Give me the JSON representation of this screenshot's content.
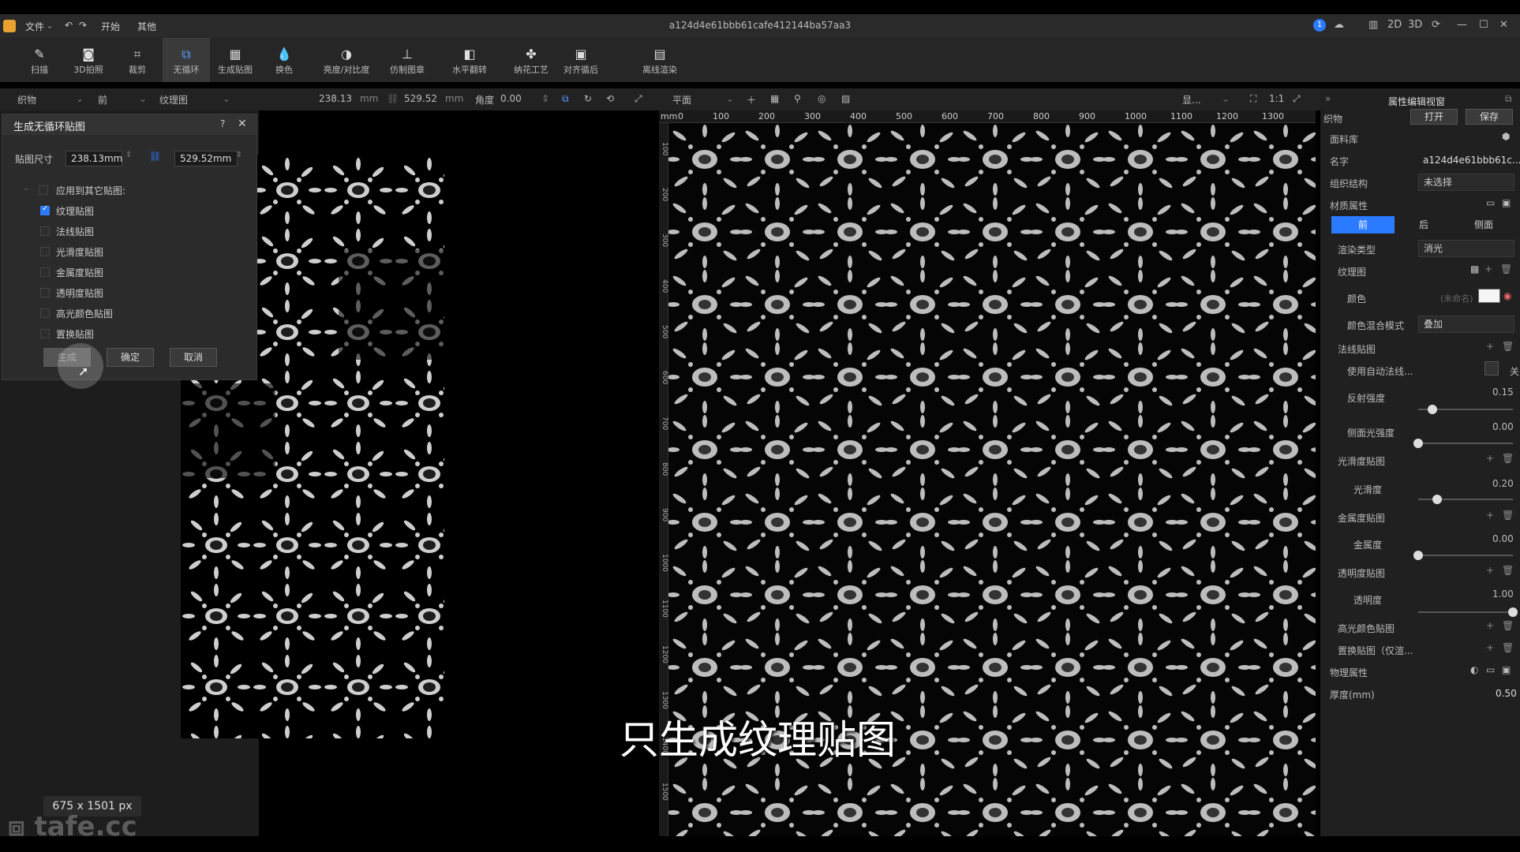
{
  "window": {
    "title": "a124d4e61bbb61cafe412144ba57aa3",
    "menu": [
      "文件",
      "开始",
      "其他"
    ],
    "right_controls": [
      "2D",
      "3D"
    ]
  },
  "toolbar": [
    {
      "label": "扫描",
      "icon": "brush-icon"
    },
    {
      "label": "3D拍照",
      "icon": "camera-icon"
    },
    {
      "label": "裁剪",
      "icon": "crop-icon"
    },
    {
      "label": "无循环",
      "icon": "seamless-icon",
      "active": true
    },
    {
      "label": "生成贴图",
      "icon": "grid-icon"
    },
    {
      "label": "换色",
      "icon": "drop-icon"
    },
    {
      "label": "亮度/对比度",
      "icon": "contrast-icon"
    },
    {
      "label": "仿制图章",
      "icon": "stamp-icon"
    },
    {
      "label": "水平翻转",
      "icon": "flip-icon"
    },
    {
      "label": "纳花工艺",
      "icon": "flower-icon"
    },
    {
      "label": "对齐循后",
      "icon": "align-icon"
    },
    {
      "label": "离线渲染",
      "icon": "render-icon"
    }
  ],
  "subbar": {
    "fabric": "织物",
    "side": "前",
    "map": "纹理图",
    "width": "238.13",
    "height": "529.52",
    "unit": "mm",
    "angle_label": "角度",
    "angle": "0.00",
    "view": "平面",
    "zoom": "1:1",
    "display": "显..."
  },
  "dialog": {
    "title": "生成无循环贴图",
    "size_label": "贴图尺寸",
    "width": "238.13mm",
    "height": "529.52mm",
    "apply_label": "应用到其它贴图:",
    "options": [
      {
        "label": "纹理贴图",
        "checked": true
      },
      {
        "label": "法线贴图",
        "checked": false
      },
      {
        "label": "光滑度贴图",
        "checked": false
      },
      {
        "label": "金属度贴图",
        "checked": false
      },
      {
        "label": "透明度贴图",
        "checked": false
      },
      {
        "label": "高光颜色贴图",
        "checked": false
      },
      {
        "label": "置换贴图",
        "checked": false
      }
    ],
    "buttons": {
      "generate": "生成",
      "ok": "确定",
      "cancel": "取消"
    }
  },
  "canvas": {
    "ruler_unit": "mm",
    "x_ticks": [
      "0",
      "100",
      "200",
      "300",
      "400",
      "500",
      "600",
      "700",
      "800",
      "900",
      "1000",
      "1100",
      "1200",
      "1300"
    ],
    "y_ticks": [
      "100",
      "200",
      "300",
      "400",
      "500",
      "600",
      "700",
      "800",
      "900",
      "1000",
      "1100",
      "1200",
      "1300",
      "1400",
      "1500"
    ]
  },
  "right_panel": {
    "title": "属性编辑视窗",
    "fabric_label": "织物",
    "open": "打开",
    "save": "保存",
    "library": "面料库",
    "name_label": "名字",
    "name_value": "a124d4e61bbb61c...",
    "structure_label": "组织结构",
    "structure_value": "未选择",
    "material_label": "材质属性",
    "tabs": [
      "前",
      "后",
      "侧面"
    ],
    "render_type_label": "渲染类型",
    "render_type_value": "消光",
    "texture_label": "纹理图",
    "color_label": "颜色",
    "color_value": "(未命名)",
    "blend_label": "颜色混合模式",
    "blend_value": "叠加",
    "normal_label": "法线贴图",
    "auto_normal_label": "使用自动法线...",
    "auto_normal_value": "关",
    "reflect_label": "反射强度",
    "reflect_value": "0.15",
    "reflect_frac": 0.15,
    "side_light_label": "侧面光强度",
    "side_light_value": "0.00",
    "side_light_frac": 0.0,
    "smooth_map_label": "光滑度贴图",
    "smooth_label": "光滑度",
    "smooth_value": "0.20",
    "smooth_frac": 0.2,
    "metal_map_label": "金属度贴图",
    "metal_label": "金属度",
    "metal_value": "0.00",
    "metal_frac": 0.0,
    "trans_map_label": "透明度贴图",
    "trans_label": "透明度",
    "trans_value": "1.00",
    "trans_frac": 1.0,
    "spec_map_label": "高光颜色贴图",
    "disp_map_label": "置换贴图（仅渲...",
    "physics_label": "物理属性",
    "thickness_label": "厚度(mm)",
    "thickness_value": "0.50"
  },
  "subtitle": "只生成纹理贴图",
  "size_badge": "675 x 1501 px",
  "watermark": "tafe.cc",
  "colors": {
    "accent": "#2a7bff",
    "logo": "#e8a030"
  }
}
